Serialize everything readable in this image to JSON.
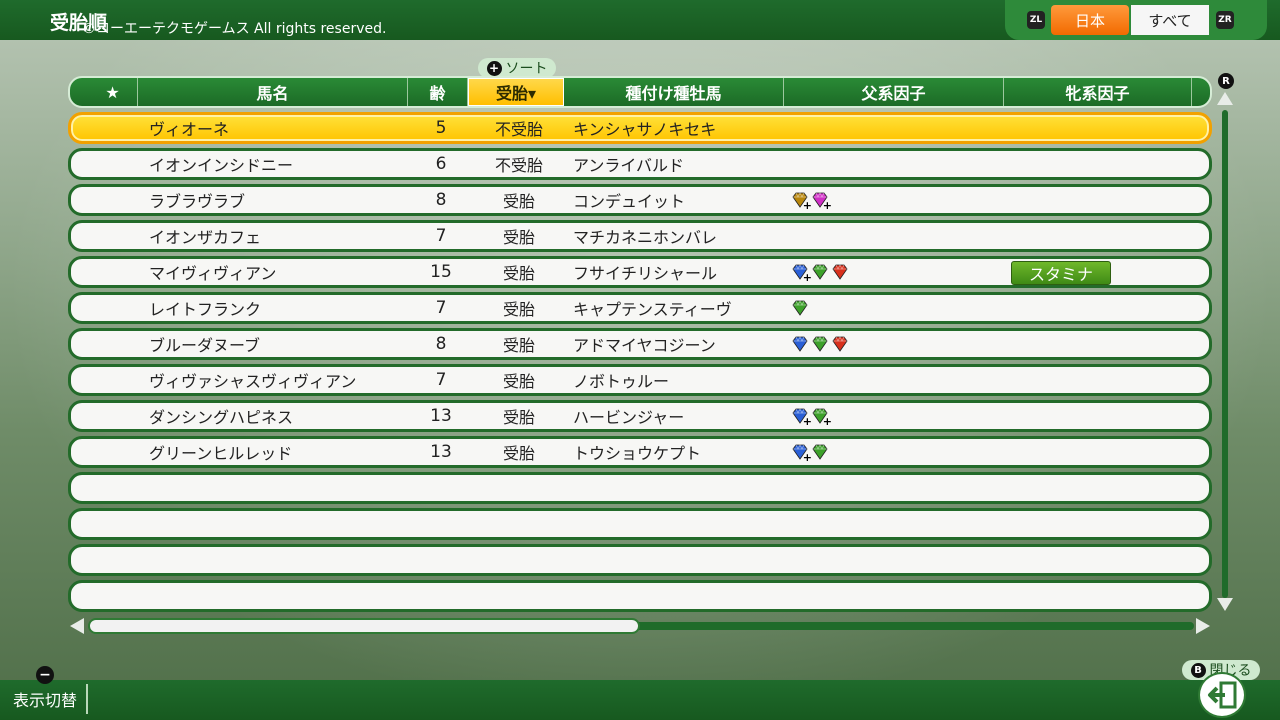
{
  "header": {
    "title": "受胎順",
    "copyright": "©コーエーテクモゲームス All rights reserved.",
    "zl_label": "ZL",
    "zr_label": "ZR",
    "tabs": [
      {
        "label": "日本",
        "active": true
      },
      {
        "label": "すべて",
        "active": false
      }
    ]
  },
  "sort": {
    "plus_label": "+",
    "label": "ソート"
  },
  "columns": {
    "star": "★",
    "name": "馬名",
    "age": "齢",
    "pregnancy": "受胎▾",
    "sire": "種付け種牡馬",
    "sire_factor": "父系因子",
    "dam_factor": "牝系因子"
  },
  "scroll": {
    "r_label": "R"
  },
  "colors": {
    "blue": "#2a5fd6",
    "green": "#3da12a",
    "red": "#d8301c",
    "gold": "#b8860b",
    "magenta": "#d02fc6"
  },
  "rows": [
    {
      "name": "ヴィオーネ",
      "age": "5",
      "pregnancy": "不受胎",
      "sire": "キンシャサノキセキ",
      "factors": [],
      "dam_factor": "",
      "selected": true
    },
    {
      "name": "イオンインシドニー",
      "age": "6",
      "pregnancy": "不受胎",
      "sire": "アンライバルド",
      "factors": [],
      "dam_factor": ""
    },
    {
      "name": "ラブラヴラブ",
      "age": "8",
      "pregnancy": "受胎",
      "sire": "コンデュイット",
      "factors": [
        {
          "color": "gold",
          "plus": true
        },
        {
          "color": "magenta",
          "plus": true
        }
      ],
      "dam_factor": ""
    },
    {
      "name": "イオンザカフェ",
      "age": "7",
      "pregnancy": "受胎",
      "sire": "マチカネニホンバレ",
      "factors": [],
      "dam_factor": ""
    },
    {
      "name": "マイヴィヴィアン",
      "age": "15",
      "pregnancy": "受胎",
      "sire": "フサイチリシャール",
      "factors": [
        {
          "color": "blue",
          "plus": true
        },
        {
          "color": "green",
          "plus": false
        },
        {
          "color": "red",
          "plus": false
        }
      ],
      "dam_factor": "スタミナ"
    },
    {
      "name": "レイトフランク",
      "age": "7",
      "pregnancy": "受胎",
      "sire": "キャプテンスティーヴ",
      "factors": [
        {
          "color": "green",
          "plus": false
        }
      ],
      "dam_factor": ""
    },
    {
      "name": "ブルーダヌーブ",
      "age": "8",
      "pregnancy": "受胎",
      "sire": "アドマイヤコジーン",
      "factors": [
        {
          "color": "blue",
          "plus": false
        },
        {
          "color": "green",
          "plus": false
        },
        {
          "color": "red",
          "plus": false
        }
      ],
      "dam_factor": ""
    },
    {
      "name": "ヴィヴァシャスヴィヴィアン",
      "age": "7",
      "pregnancy": "受胎",
      "sire": "ノボトゥルー",
      "factors": [],
      "dam_factor": ""
    },
    {
      "name": "ダンシングハピネス",
      "age": "13",
      "pregnancy": "受胎",
      "sire": "ハービンジャー",
      "factors": [
        {
          "color": "blue",
          "plus": true
        },
        {
          "color": "green",
          "plus": true
        }
      ],
      "dam_factor": ""
    },
    {
      "name": "グリーンヒルレッド",
      "age": "13",
      "pregnancy": "受胎",
      "sire": "トウショウケプト",
      "factors": [
        {
          "color": "blue",
          "plus": true
        },
        {
          "color": "green",
          "plus": false
        }
      ],
      "dam_factor": ""
    },
    {
      "name": "",
      "age": "",
      "pregnancy": "",
      "sire": "",
      "factors": [],
      "dam_factor": ""
    },
    {
      "name": "",
      "age": "",
      "pregnancy": "",
      "sire": "",
      "factors": [],
      "dam_factor": ""
    },
    {
      "name": "",
      "age": "",
      "pregnancy": "",
      "sire": "",
      "factors": [],
      "dam_factor": ""
    },
    {
      "name": "",
      "age": "",
      "pregnancy": "",
      "sire": "",
      "factors": [],
      "dam_factor": ""
    }
  ],
  "footer": {
    "minus_label": "−",
    "toggle_label": "表示切替",
    "b_label": "B",
    "close_label": "閉じる"
  }
}
